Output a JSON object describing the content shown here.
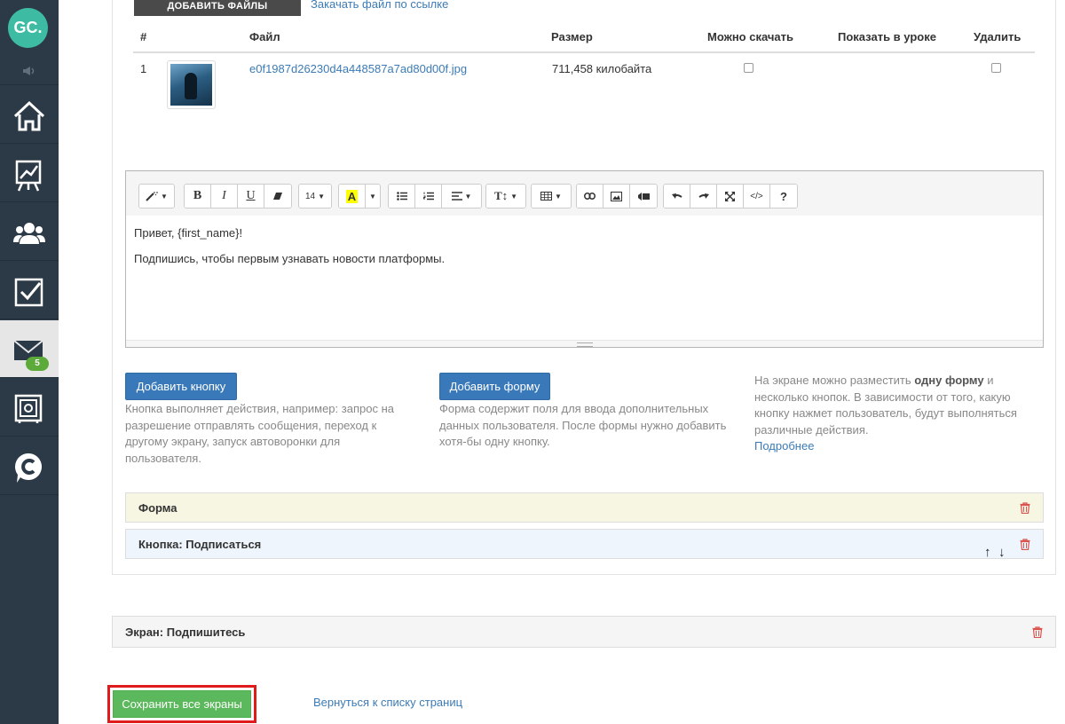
{
  "sidebar": {
    "logo_text": "GC.",
    "badge": "5",
    "items": [
      {
        "icon": "home-icon"
      },
      {
        "icon": "chart-icon"
      },
      {
        "icon": "users-icon"
      },
      {
        "icon": "tasks-icon"
      },
      {
        "icon": "mail-icon"
      },
      {
        "icon": "safe-icon"
      },
      {
        "icon": "chat-icon"
      }
    ]
  },
  "files": {
    "upload_label": "ДОБАВИТЬ ФАЙЛЫ",
    "url_link": "Закачать файл по ссылке",
    "headers": {
      "num": "#",
      "file": "Файл",
      "size": "Размер",
      "download": "Можно скачать",
      "show": "Показать в уроке",
      "delete": "Удалить"
    },
    "rows": [
      {
        "num": "1",
        "name": "e0f1987d26230d4a448587a7ad80d00f.jpg",
        "size": "711,458 килобайта",
        "download": false,
        "delete": false
      }
    ]
  },
  "editor": {
    "font_size": "14",
    "lines": [
      "Привет, {first_name}!",
      "Подпишись, чтобы первым узнавать новости платформы."
    ]
  },
  "actions": {
    "add_button_label": "Добавить кнопку",
    "add_button_help": "Кнопка выполняет действия, например: запрос на разрешение отправлять сообщения, переход к другому экрану, запуск автоворонки для пользователя.",
    "add_form_label": "Добавить форму",
    "add_form_help": "Форма содержит поля для ввода дополнительных данных пользователя. После формы нужно добавить хотя-бы одну кнопку.",
    "info_pre": "На экране можно разместить ",
    "info_bold": "одну форму",
    "info_post": " и несколько кнопок. В зависимости от того, какую кнопку нажмет пользователь, будут выполняться различные действия.",
    "more_link": "Подробнее"
  },
  "blocks": {
    "form_title": "Форма",
    "button_title": "Кнопка: Подписаться",
    "screen_title": "Экран: Подпишитесь"
  },
  "footer": {
    "save_label": "Сохранить все экраны",
    "back_link": "Вернуться к списку страниц"
  },
  "colors": {
    "sidebar": "#2c3a47",
    "logo": "#3dbba3",
    "primary": "#3979b9",
    "success": "#5cb85c",
    "highlight": "#e11b1b",
    "form_bg": "#f7f6e3",
    "button_bg": "#eef5fc"
  }
}
